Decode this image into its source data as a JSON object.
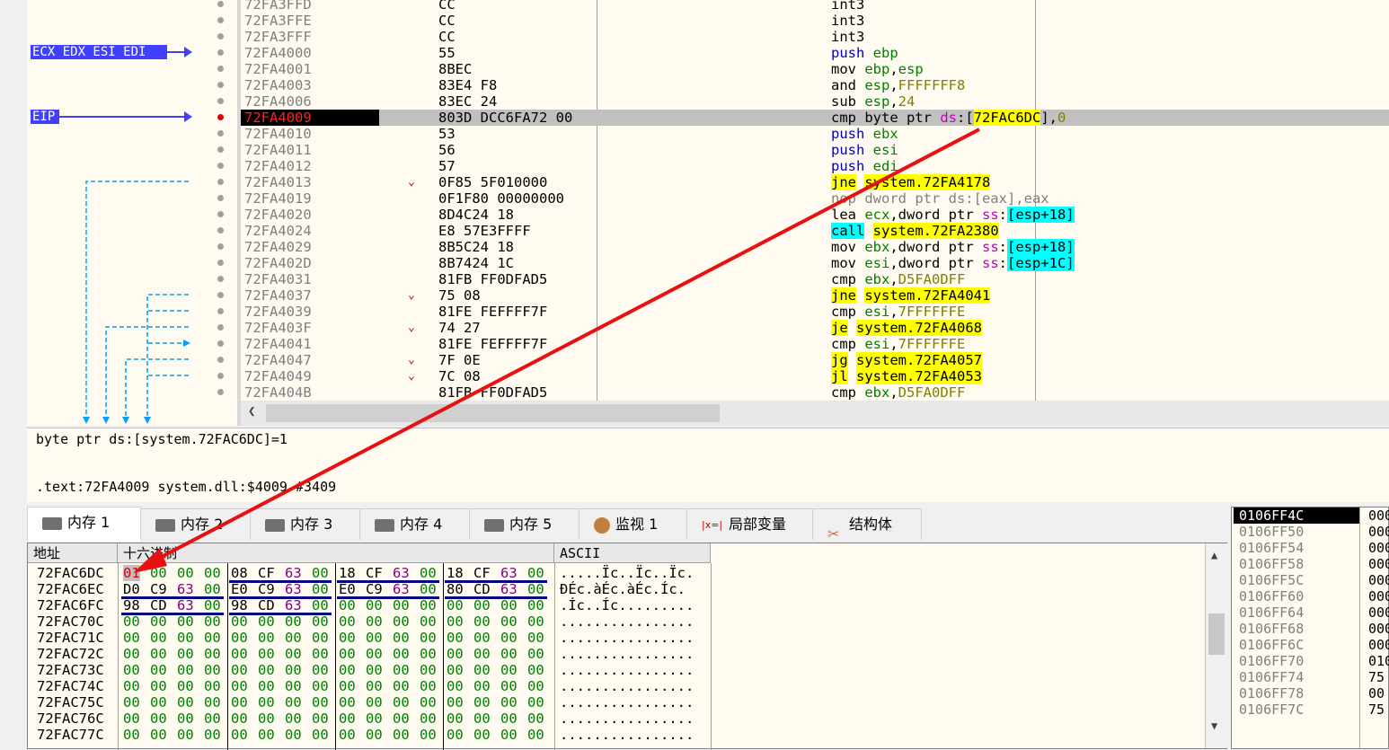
{
  "labels": {
    "registers": "ECX EDX ESI EDI",
    "eip": "EIP"
  },
  "disasm": [
    {
      "addr": "72FA3FFD",
      "bytes": "CC",
      "arrow": "",
      "ins": [
        {
          "t": "int3"
        }
      ]
    },
    {
      "addr": "72FA3FFE",
      "bytes": "CC",
      "arrow": "",
      "ins": [
        {
          "t": "int3"
        }
      ]
    },
    {
      "addr": "72FA3FFF",
      "bytes": "CC",
      "arrow": "",
      "ins": [
        {
          "t": "int3"
        }
      ]
    },
    {
      "addr": "72FA4000",
      "bytes": "55",
      "arrow": "",
      "ins": [
        {
          "t": "push ",
          "c": "mn-blue"
        },
        {
          "t": "ebp",
          "c": "reg"
        }
      ]
    },
    {
      "addr": "72FA4001",
      "bytes": "8BEC",
      "arrow": "",
      "ins": [
        {
          "t": "mov "
        },
        {
          "t": "ebp",
          "c": "reg"
        },
        {
          "t": ","
        },
        {
          "t": "esp",
          "c": "reg"
        }
      ]
    },
    {
      "addr": "72FA4003",
      "bytes": "83E4 F8",
      "arrow": "",
      "ins": [
        {
          "t": "and "
        },
        {
          "t": "esp",
          "c": "reg"
        },
        {
          "t": ","
        },
        {
          "t": "FFFFFFF8",
          "c": "imm"
        }
      ]
    },
    {
      "addr": "72FA4006",
      "bytes": "83EC 24",
      "arrow": "",
      "ins": [
        {
          "t": "sub "
        },
        {
          "t": "esp",
          "c": "reg"
        },
        {
          "t": ","
        },
        {
          "t": "24",
          "c": "imm"
        }
      ]
    },
    {
      "addr": "72FA4009",
      "bytes": "803D DCC6FA72 00",
      "arrow": "",
      "sel": true,
      "ins": [
        {
          "t": "cmp byte ptr "
        },
        {
          "t": "ds",
          "c": "seg"
        },
        {
          "t": ":["
        },
        {
          "t": "72FAC6DC",
          "c": "mn-yel"
        },
        {
          "t": "],"
        },
        {
          "t": "0",
          "c": "imm"
        }
      ]
    },
    {
      "addr": "72FA4010",
      "bytes": "53",
      "arrow": "",
      "ins": [
        {
          "t": "push ",
          "c": "mn-blue"
        },
        {
          "t": "ebx",
          "c": "reg"
        }
      ]
    },
    {
      "addr": "72FA4011",
      "bytes": "56",
      "arrow": "",
      "ins": [
        {
          "t": "push ",
          "c": "mn-blue"
        },
        {
          "t": "esi",
          "c": "reg"
        }
      ]
    },
    {
      "addr": "72FA4012",
      "bytes": "57",
      "arrow": "",
      "ins": [
        {
          "t": "push ",
          "c": "mn-blue"
        },
        {
          "t": "edi",
          "c": "reg"
        }
      ]
    },
    {
      "addr": "72FA4013",
      "bytes": "0F85 5F010000",
      "arrow": "⌄",
      "ins": [
        {
          "t": "jne",
          "c": "mn-yel"
        },
        {
          "t": " "
        },
        {
          "t": "system.72FA4178",
          "c": "mn-yel"
        }
      ]
    },
    {
      "addr": "72FA4019",
      "bytes": "0F1F80 00000000",
      "arrow": "",
      "ins": [
        {
          "t": "nop dword ptr ds:[eax],eax",
          "c": "gray"
        }
      ]
    },
    {
      "addr": "72FA4020",
      "bytes": "8D4C24 18",
      "arrow": "",
      "ins": [
        {
          "t": "lea "
        },
        {
          "t": "ecx",
          "c": "reg"
        },
        {
          "t": ",dword ptr "
        },
        {
          "t": "ss",
          "c": "seg"
        },
        {
          "t": ":"
        },
        {
          "t": "[esp+18]",
          "c": "mn-cyan"
        }
      ]
    },
    {
      "addr": "72FA4024",
      "bytes": "E8 57E3FFFF",
      "arrow": "",
      "ins": [
        {
          "t": "call",
          "c": "mn-cyan"
        },
        {
          "t": " "
        },
        {
          "t": "system.72FA2380",
          "c": "mn-yel"
        }
      ]
    },
    {
      "addr": "72FA4029",
      "bytes": "8B5C24 18",
      "arrow": "",
      "ins": [
        {
          "t": "mov "
        },
        {
          "t": "ebx",
          "c": "reg"
        },
        {
          "t": ",dword ptr "
        },
        {
          "t": "ss",
          "c": "seg"
        },
        {
          "t": ":"
        },
        {
          "t": "[esp+18]",
          "c": "mn-cyan"
        }
      ]
    },
    {
      "addr": "72FA402D",
      "bytes": "8B7424 1C",
      "arrow": "",
      "ins": [
        {
          "t": "mov "
        },
        {
          "t": "esi",
          "c": "reg"
        },
        {
          "t": ",dword ptr "
        },
        {
          "t": "ss",
          "c": "seg"
        },
        {
          "t": ":"
        },
        {
          "t": "[esp+1C]",
          "c": "mn-cyan"
        }
      ]
    },
    {
      "addr": "72FA4031",
      "bytes": "81FB FF0DFAD5",
      "arrow": "",
      "ins": [
        {
          "t": "cmp "
        },
        {
          "t": "ebx",
          "c": "reg"
        },
        {
          "t": ","
        },
        {
          "t": "D5FA0DFF",
          "c": "imm"
        }
      ]
    },
    {
      "addr": "72FA4037",
      "bytes": "75 08",
      "arrow": "⌄",
      "ins": [
        {
          "t": "jne",
          "c": "mn-yel"
        },
        {
          "t": " "
        },
        {
          "t": "system.72FA4041",
          "c": "mn-yel"
        }
      ]
    },
    {
      "addr": "72FA4039",
      "bytes": "81FE FEFFFF7F",
      "arrow": "",
      "ins": [
        {
          "t": "cmp "
        },
        {
          "t": "esi",
          "c": "reg"
        },
        {
          "t": ","
        },
        {
          "t": "7FFFFFFE",
          "c": "imm"
        }
      ]
    },
    {
      "addr": "72FA403F",
      "bytes": "74 27",
      "arrow": "⌄",
      "ins": [
        {
          "t": "je",
          "c": "mn-yel"
        },
        {
          "t": " "
        },
        {
          "t": "system.72FA4068",
          "c": "mn-yel"
        }
      ]
    },
    {
      "addr": "72FA4041",
      "bytes": "81FE FEFFFF7F",
      "arrow": "",
      "ins": [
        {
          "t": "cmp "
        },
        {
          "t": "esi",
          "c": "reg"
        },
        {
          "t": ","
        },
        {
          "t": "7FFFFFFE",
          "c": "imm"
        }
      ]
    },
    {
      "addr": "72FA4047",
      "bytes": "7F 0E",
      "arrow": "⌄",
      "ins": [
        {
          "t": "jg",
          "c": "mn-yel"
        },
        {
          "t": " "
        },
        {
          "t": "system.72FA4057",
          "c": "mn-yel"
        }
      ]
    },
    {
      "addr": "72FA4049",
      "bytes": "7C 08",
      "arrow": "⌄",
      "ins": [
        {
          "t": "jl",
          "c": "mn-yel"
        },
        {
          "t": " "
        },
        {
          "t": "system.72FA4053",
          "c": "mn-yel"
        }
      ]
    },
    {
      "addr": "72FA404B",
      "bytes": "81FB FF0DFAD5",
      "arrow": "",
      "ins": [
        {
          "t": "cmp "
        },
        {
          "t": "ebx",
          "c": "reg"
        },
        {
          "t": ","
        },
        {
          "t": "D5FA0DFF",
          "c": "imm"
        }
      ]
    }
  ],
  "info": {
    "line1": "byte ptr ds:[system.72FAC6DC]=1",
    "line2": ".text:72FA4009 system.dll:$4009 #3409"
  },
  "tabs": [
    {
      "label": "内存 1",
      "icon": "memory-icon",
      "active": true
    },
    {
      "label": "内存 2",
      "icon": "memory-icon"
    },
    {
      "label": "内存 3",
      "icon": "memory-icon"
    },
    {
      "label": "内存 4",
      "icon": "memory-icon"
    },
    {
      "label": "内存 5",
      "icon": "memory-icon"
    },
    {
      "label": "监视 1",
      "icon": "watch-icon"
    },
    {
      "label": "局部变量",
      "icon": "variable-icon"
    },
    {
      "label": "结构体",
      "icon": "struct-icon"
    }
  ],
  "dump": {
    "headers": {
      "addr": "地址",
      "hex": "十六进制",
      "ascii": "ASCII"
    },
    "rows": [
      {
        "addr": "72FAC6DC",
        "bytes": [
          "01",
          "00",
          "00",
          "00",
          "08",
          "CF",
          "63",
          "00",
          "18",
          "CF",
          "63",
          "00",
          "18",
          "CF",
          "63",
          "00"
        ],
        "ascii": ".....Ïc..Ïc..Ïc."
      },
      {
        "addr": "72FAC6EC",
        "bytes": [
          "D0",
          "C9",
          "63",
          "00",
          "E0",
          "C9",
          "63",
          "00",
          "E0",
          "C9",
          "63",
          "00",
          "80",
          "CD",
          "63",
          "00"
        ],
        "ascii": "ÐÉc.àÉc.àÉc.Íc."
      },
      {
        "addr": "72FAC6FC",
        "bytes": [
          "98",
          "CD",
          "63",
          "00",
          "98",
          "CD",
          "63",
          "00",
          "00",
          "00",
          "00",
          "00",
          "00",
          "00",
          "00",
          "00"
        ],
        "ascii": ".Íc..Íc........."
      },
      {
        "addr": "72FAC70C",
        "bytes": [
          "00",
          "00",
          "00",
          "00",
          "00",
          "00",
          "00",
          "00",
          "00",
          "00",
          "00",
          "00",
          "00",
          "00",
          "00",
          "00"
        ],
        "ascii": "................"
      },
      {
        "addr": "72FAC71C",
        "bytes": [
          "00",
          "00",
          "00",
          "00",
          "00",
          "00",
          "00",
          "00",
          "00",
          "00",
          "00",
          "00",
          "00",
          "00",
          "00",
          "00"
        ],
        "ascii": "................"
      },
      {
        "addr": "72FAC72C",
        "bytes": [
          "00",
          "00",
          "00",
          "00",
          "00",
          "00",
          "00",
          "00",
          "00",
          "00",
          "00",
          "00",
          "00",
          "00",
          "00",
          "00"
        ],
        "ascii": "................"
      },
      {
        "addr": "72FAC73C",
        "bytes": [
          "00",
          "00",
          "00",
          "00",
          "00",
          "00",
          "00",
          "00",
          "00",
          "00",
          "00",
          "00",
          "00",
          "00",
          "00",
          "00"
        ],
        "ascii": "................"
      },
      {
        "addr": "72FAC74C",
        "bytes": [
          "00",
          "00",
          "00",
          "00",
          "00",
          "00",
          "00",
          "00",
          "00",
          "00",
          "00",
          "00",
          "00",
          "00",
          "00",
          "00"
        ],
        "ascii": "................"
      },
      {
        "addr": "72FAC75C",
        "bytes": [
          "00",
          "00",
          "00",
          "00",
          "00",
          "00",
          "00",
          "00",
          "00",
          "00",
          "00",
          "00",
          "00",
          "00",
          "00",
          "00"
        ],
        "ascii": "................"
      },
      {
        "addr": "72FAC76C",
        "bytes": [
          "00",
          "00",
          "00",
          "00",
          "00",
          "00",
          "00",
          "00",
          "00",
          "00",
          "00",
          "00",
          "00",
          "00",
          "00",
          "00"
        ],
        "ascii": "................"
      },
      {
        "addr": "72FAC77C",
        "bytes": [
          "00",
          "00",
          "00",
          "00",
          "00",
          "00",
          "00",
          "00",
          "00",
          "00",
          "00",
          "00",
          "00",
          "00",
          "00",
          "00"
        ],
        "ascii": "................"
      }
    ]
  },
  "stack": [
    {
      "addr": "0106FF4C",
      "val": "000",
      "sel": true
    },
    {
      "addr": "0106FF50",
      "val": "000"
    },
    {
      "addr": "0106FF54",
      "val": "000"
    },
    {
      "addr": "0106FF58",
      "val": "000"
    },
    {
      "addr": "0106FF5C",
      "val": "000"
    },
    {
      "addr": "0106FF60",
      "val": "000"
    },
    {
      "addr": "0106FF64",
      "val": "000"
    },
    {
      "addr": "0106FF68",
      "val": "000"
    },
    {
      "addr": "0106FF6C",
      "val": "000"
    },
    {
      "addr": "0106FF70",
      "val": "010"
    },
    {
      "addr": "0106FF74",
      "val": "75"
    },
    {
      "addr": "0106FF78",
      "val": "00"
    },
    {
      "addr": "0106FF7C",
      "val": "75"
    }
  ]
}
